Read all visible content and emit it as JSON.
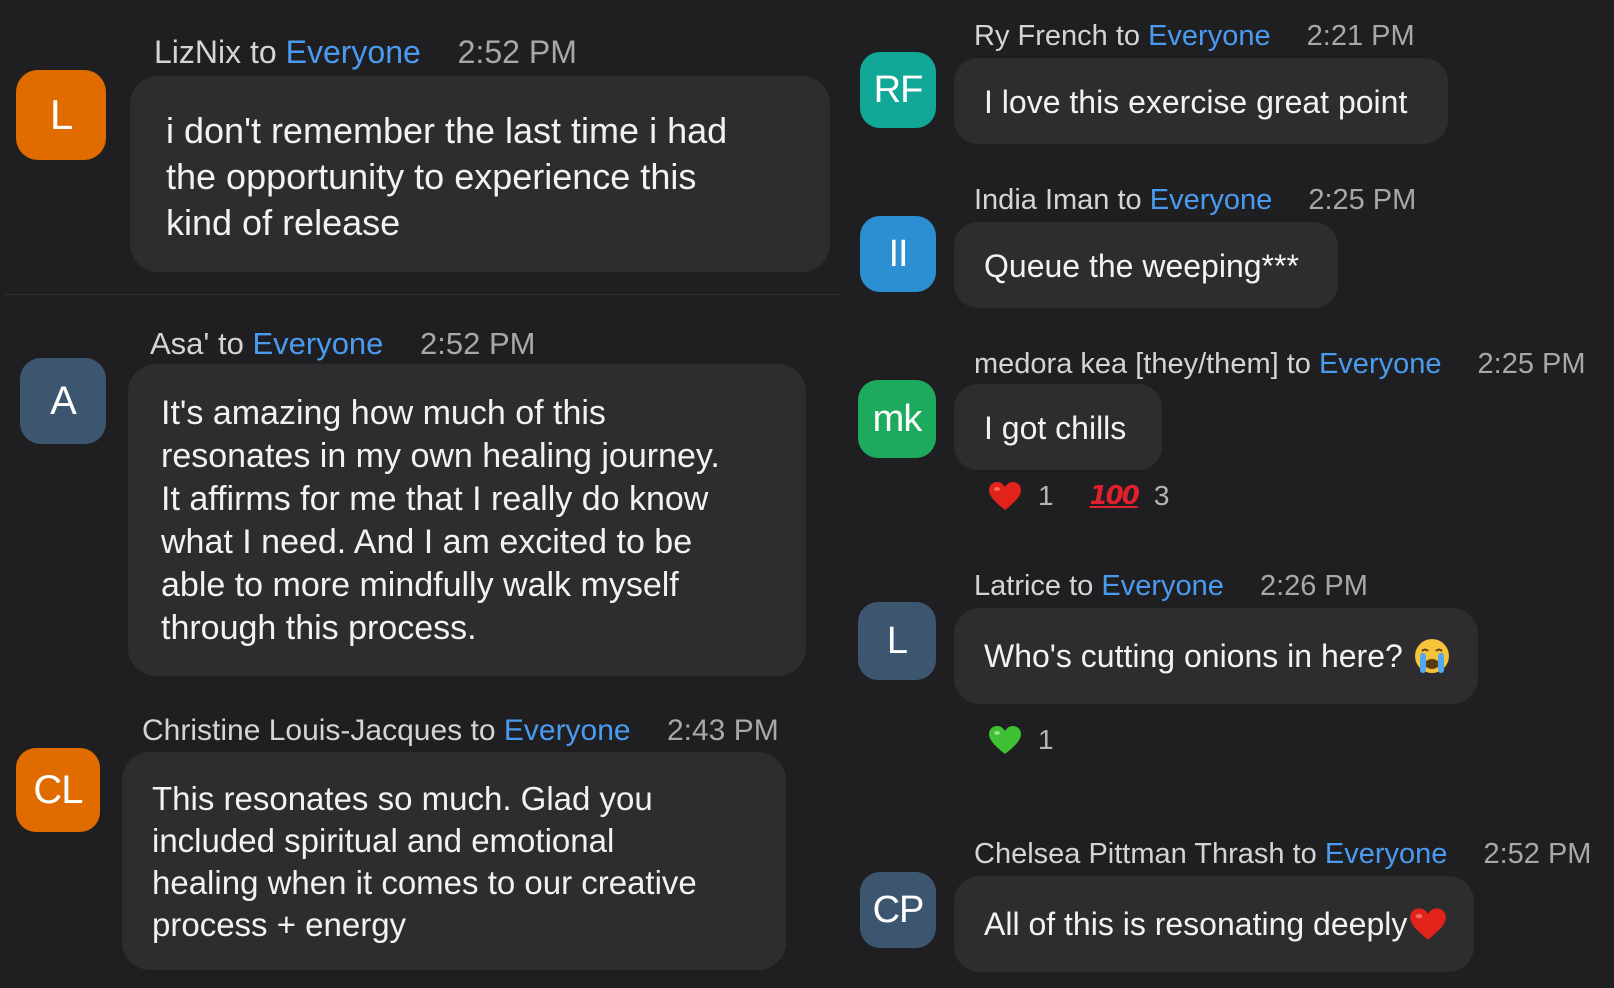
{
  "colors": {
    "background": "#1f1f21",
    "bubble": "#2d2d30",
    "everyone_link": "#4a9bf0",
    "timestamp": "#a8a8ab"
  },
  "left_messages": [
    {
      "initials": "L",
      "avatar_color": "#e06c00",
      "sender": "LizNix",
      "to": "to",
      "recipient": "Everyone",
      "time": "2:52 PM",
      "text": "i don't remember the last time i had\nthe opportunity to experience this\nkind of release"
    },
    {
      "initials": "A",
      "avatar_color": "#3d5670",
      "sender": "Asa'",
      "to": "to",
      "recipient": "Everyone",
      "time": "2:52 PM",
      "text": "It's amazing how much of this\nresonates in my own healing journey.\nIt affirms for me that I really do know\nwhat I need. And I am excited to be\nable to more mindfully walk myself\nthrough this process."
    },
    {
      "initials": "CL",
      "avatar_color": "#e06c00",
      "sender": "Christine Louis-Jacques",
      "to": "to",
      "recipient": "Everyone",
      "time": "2:43 PM",
      "text": "This resonates so much. Glad you\nincluded spiritual and emotional\nhealing when it comes to our creative\nprocess + energy"
    }
  ],
  "right_messages": [
    {
      "initials": "RF",
      "avatar_color": "#11a898",
      "sender": "Ry French",
      "to": "to",
      "recipient": "Everyone",
      "time": "2:21 PM",
      "text": "I love this exercise great point"
    },
    {
      "initials": "II",
      "avatar_color": "#2b8fd1",
      "sender": "India Iman",
      "to": "to",
      "recipient": "Everyone",
      "time": "2:25 PM",
      "text": "Queue the weeping***"
    },
    {
      "initials": "mk",
      "avatar_color": "#1eaa5e",
      "sender": "medora kea [they/them]",
      "to": "to",
      "recipient": "Everyone",
      "time": "2:25 PM",
      "text": "I got chills",
      "reactions": [
        {
          "emoji": "red-heart",
          "count": "1"
        },
        {
          "emoji": "hundred-points",
          "symbol": "100",
          "count": "3"
        }
      ]
    },
    {
      "initials": "L",
      "avatar_color": "#3d5670",
      "sender": "Latrice",
      "to": "to",
      "recipient": "Everyone",
      "time": "2:26 PM",
      "text": "Who's cutting onions in here?",
      "trailing_emoji": "loudly-crying-face",
      "reactions": [
        {
          "emoji": "green-heart",
          "count": "1"
        }
      ]
    },
    {
      "initials": "CP",
      "avatar_color": "#3d5670",
      "sender": "Chelsea Pittman Thrash",
      "to": "to",
      "recipient": "Everyone",
      "time": "2:52 PM",
      "text": "All of this is resonating deeply",
      "trailing_emoji": "red-heart"
    }
  ]
}
